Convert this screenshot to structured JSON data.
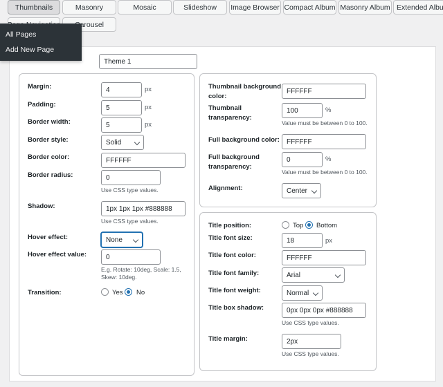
{
  "tabs": [
    {
      "label": "Thumbnails",
      "active": true
    },
    {
      "label": "Masonry"
    },
    {
      "label": "Mosaic"
    },
    {
      "label": "Slideshow"
    },
    {
      "label": "Image Browser"
    },
    {
      "label": "Compact Album"
    },
    {
      "label": "Masonry Album"
    },
    {
      "label": "Extended Album"
    },
    {
      "label": "Page Navigation"
    },
    {
      "label": "Carousel"
    }
  ],
  "admin_menu": {
    "items": [
      "All Pages",
      "Add New Page"
    ]
  },
  "theme_name": "Theme 1",
  "left_panel": {
    "margin": {
      "label": "Margin:",
      "value": "4",
      "unit": "px"
    },
    "padding": {
      "label": "Padding:",
      "value": "5",
      "unit": "px"
    },
    "border_width": {
      "label": "Border width:",
      "value": "5",
      "unit": "px"
    },
    "border_style": {
      "label": "Border style:",
      "value": "Solid"
    },
    "border_color": {
      "label": "Border color:",
      "value": "FFFFFF"
    },
    "border_radius": {
      "label": "Border radius:",
      "value": "0",
      "hint": "Use CSS type values."
    },
    "shadow": {
      "label": "Shadow:",
      "value": "1px 1px 1px #888888",
      "hint": "Use CSS type values."
    },
    "hover_effect": {
      "label": "Hover effect:",
      "value": "None"
    },
    "hover_effect_value": {
      "label": "Hover effect value:",
      "value": "0",
      "hint1": "E.g. Rotate: 10deg, Scale: 1.5,",
      "hint2": "Skew: 10deg."
    },
    "transition": {
      "label": "Transition:",
      "yes": "Yes",
      "no": "No",
      "selected": "no"
    }
  },
  "right_top": {
    "thumb_bg_color": {
      "label1": "Thumbnail background",
      "label2": "color:",
      "value": "FFFFFF"
    },
    "thumb_transparency": {
      "label1": "Thumbnail",
      "label2": "transparency:",
      "value": "100",
      "unit": "%",
      "hint": "Value must be between 0 to 100."
    },
    "full_bg_color": {
      "label": "Full background color:",
      "value": "FFFFFF"
    },
    "full_bg_transparency": {
      "label1": "Full background",
      "label2": "transparency:",
      "value": "0",
      "unit": "%",
      "hint": "Value must be between 0 to 100."
    },
    "alignment": {
      "label": "Alignment:",
      "value": "Center"
    }
  },
  "right_bottom": {
    "title_position": {
      "label": "Title position:",
      "top": "Top",
      "bottom": "Bottom",
      "selected": "bottom"
    },
    "title_font_size": {
      "label": "Title font size:",
      "value": "18",
      "unit": "px"
    },
    "title_font_color": {
      "label": "Title font color:",
      "value": "FFFFFF"
    },
    "title_font_family": {
      "label": "Title font family:",
      "value": "Arial"
    },
    "title_font_weight": {
      "label": "Title font weight:",
      "value": "Normal"
    },
    "title_box_shadow": {
      "label": "Title box shadow:",
      "value": "0px 0px 0px #888888",
      "hint": "Use CSS type values."
    },
    "title_margin": {
      "label": "Title margin:",
      "value": "2px",
      "hint": "Use CSS type values."
    }
  }
}
